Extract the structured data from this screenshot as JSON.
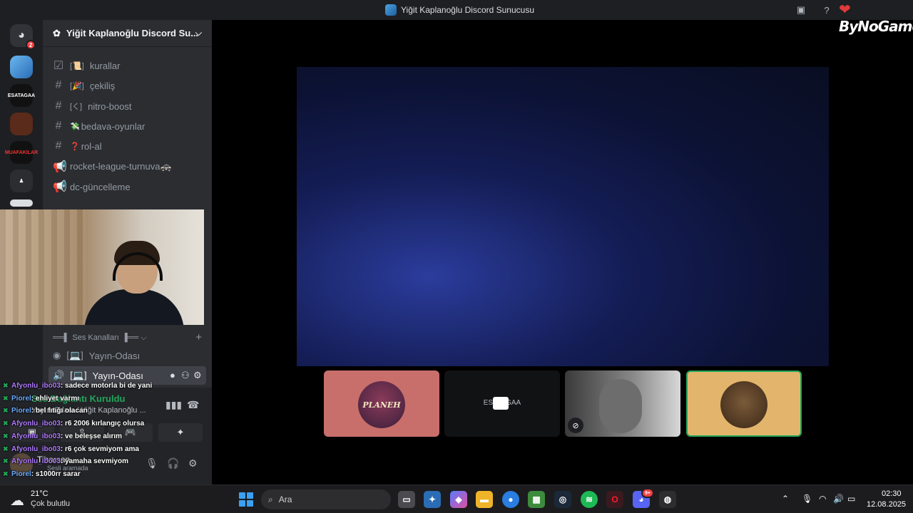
{
  "window": {
    "title": "Yiğit Kaplanoğlu Discord Sunucusu",
    "watermark": "ByNoGame"
  },
  "rail": {
    "home_badge": "2",
    "servers": [
      "ESATAGAA",
      "MUAFAKILAR"
    ]
  },
  "server": {
    "name": "Yiğit Kaplanoğlu Discord Su..."
  },
  "channels": [
    {
      "prefix": "[📜]",
      "name": "kurallar"
    },
    {
      "prefix": "[🎉]",
      "name": "çekiliş"
    },
    {
      "prefix": "[く]",
      "name": "nitro-boost"
    },
    {
      "prefix": "💸",
      "name": "bedava-oyunlar"
    },
    {
      "prefix": "❓",
      "name": "rol-al"
    },
    {
      "prefix": "",
      "name": "rocket-league-turnuva🚓"
    },
    {
      "prefix": "",
      "name": "dc-güncelleme"
    }
  ],
  "voice": {
    "category": "Ses Kanalları",
    "channels": [
      {
        "prefix": "[💻]",
        "name": "Yayın-Odası"
      },
      {
        "prefix": "[💻]",
        "name": "Yayın-Odası"
      }
    ]
  },
  "voice_panel": {
    "status": "Ses Bağlantı Kuruldu",
    "sub": "Yayın-Odası / Yiğit Kaplanoğlu ...",
    "user_name": "Tibarsan",
    "user_status": "Sesli aramada"
  },
  "chat": [
    {
      "user": "Afyonlu_ibo03",
      "msg": ": sadece motorla bi de yani"
    },
    {
      "user": "Piorel",
      "msg": ": ehliyet varmı"
    },
    {
      "user": "Piorel",
      "msg": ": bel fıtığı olacan"
    },
    {
      "user": "Afyonlu_ibo03",
      "msg": ": r6 2006 kırlangıç olursa"
    },
    {
      "user": "Afyonlu_ibo03",
      "msg": ": ve beleşse alırım"
    },
    {
      "user": "Afyonlu_ibo03",
      "msg": ": r6 çok sevmiyom ama"
    },
    {
      "user": "Afyonlu_ibo03",
      "msg": ": yamaha sevmiyom"
    },
    {
      "user": "Piorel",
      "msg": ": s1000rr sarar"
    }
  ],
  "tiles": [
    {
      "label": "PLANEH"
    },
    {
      "label": "ESATAGAA"
    },
    {
      "label": ""
    },
    {
      "label": ""
    }
  ],
  "taskbar": {
    "temp": "21°C",
    "weather": "Çok bulutlu",
    "search_placeholder": "Ara",
    "time": "02:30",
    "date": "12.08.2025",
    "discord_badge": "9+"
  },
  "colors": {
    "connected": "#23a55a",
    "accent": "#5865f2",
    "danger": "#f23f43"
  }
}
